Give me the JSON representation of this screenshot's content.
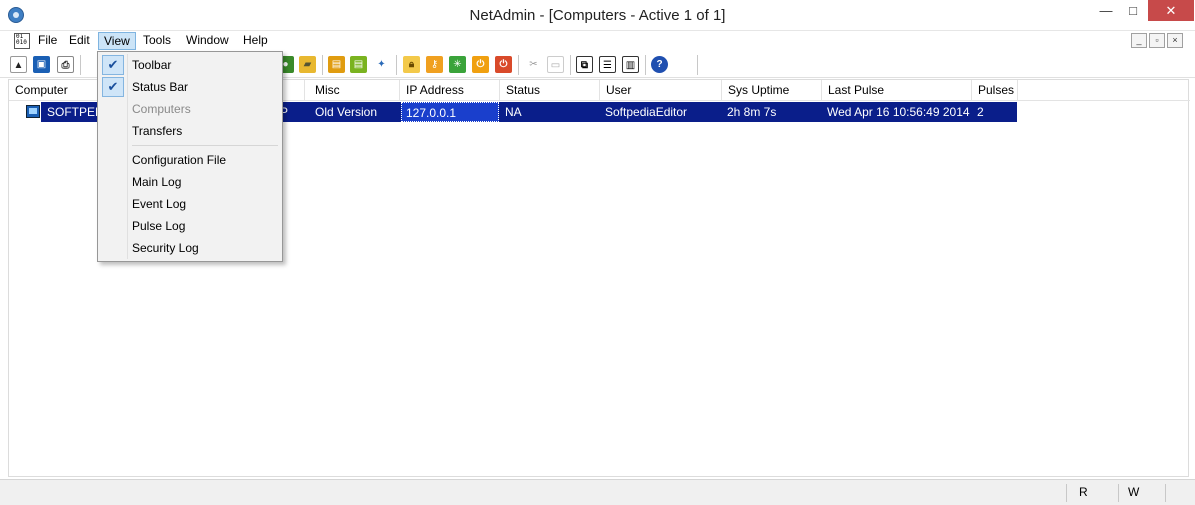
{
  "window": {
    "title": "NetAdmin - [Computers - Active 1 of 1]",
    "minimize_glyph": "—",
    "maximize_glyph": "□",
    "close_glyph": "✕"
  },
  "menubar": {
    "doc_icon_text": "01 010",
    "items": [
      {
        "label": "File"
      },
      {
        "label": "Edit"
      },
      {
        "label": "View",
        "active": true
      },
      {
        "label": "Tools"
      },
      {
        "label": "Window"
      },
      {
        "label": "Help"
      }
    ],
    "mdi_buttons": [
      "_",
      "▫",
      "×"
    ]
  },
  "toolbar": {
    "icons": [
      "tree-icon",
      "computer-icon",
      "print-icon",
      "cut-icon",
      "scan-icon",
      "scan-icon-2",
      "folder-icon",
      "card-icon",
      "card-green-icon",
      "wizard-icon",
      "lock-icon",
      "key-icon",
      "refresh-icon",
      "power-icon",
      "shutdown-icon",
      "scissors-icon",
      "paste-icon",
      "cascade-icon",
      "tile-horizontal-icon",
      "tile-vertical-icon",
      "help-icon"
    ]
  },
  "listview": {
    "columns": [
      "Computer",
      "Misc",
      "IP Address",
      "Status",
      "User",
      "Sys Uptime",
      "Last Pulse",
      "Pulses"
    ],
    "rows": [
      {
        "computer": "SOFTPEDIA",
        "suffix": "P",
        "misc": "Old Version",
        "ip": "127.0.0.1",
        "status": "NA",
        "user": "SoftpediaEditor",
        "uptime": "2h 8m 7s",
        "last_pulse": "Wed Apr 16 10:56:49 2014",
        "pulses": "2"
      }
    ]
  },
  "view_menu": {
    "items": [
      {
        "label": "Toolbar",
        "checked": true
      },
      {
        "label": "Status Bar",
        "checked": true
      },
      {
        "label": "Computers",
        "disabled": true
      },
      {
        "label": "Transfers"
      },
      {
        "label": "Configuration File"
      },
      {
        "label": "Main Log"
      },
      {
        "label": "Event Log"
      },
      {
        "label": "Pulse Log"
      },
      {
        "label": "Security Log"
      }
    ],
    "check_glyph": "✔"
  },
  "statusbar": {
    "r_label": "R",
    "w_label": "W"
  }
}
